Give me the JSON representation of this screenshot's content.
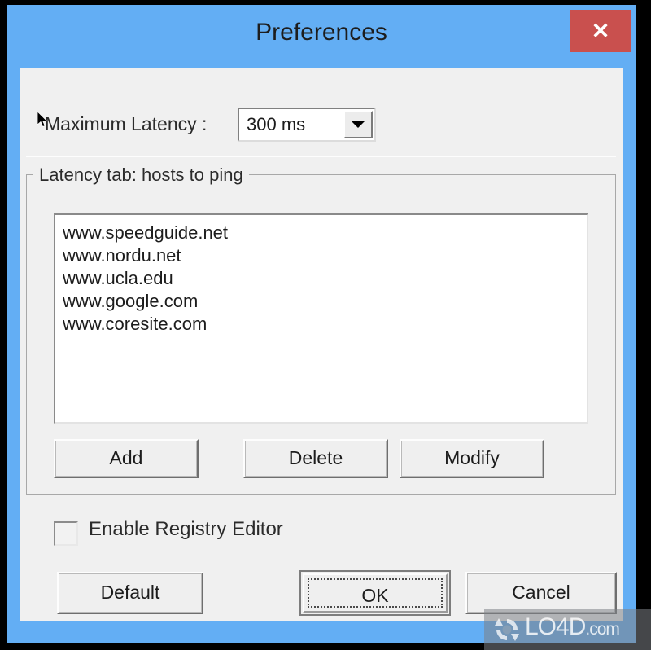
{
  "window": {
    "title": "Preferences",
    "close_label": "✕",
    "frame_color": "#63aef4",
    "close_color": "#c9504e",
    "client_color": "#f0f0f0"
  },
  "latency": {
    "label": "Maximum Latency :",
    "selected": "300 ms",
    "options": [
      "300 ms"
    ],
    "dropdown_icon": "chevron-down-icon"
  },
  "hosts_group": {
    "legend": "Latency tab: hosts to ping",
    "items": [
      "www.speedguide.net",
      "www.nordu.net",
      "www.ucla.edu",
      "www.google.com",
      "www.coresite.com"
    ],
    "buttons": {
      "add": "Add",
      "delete": "Delete",
      "modify": "Modify"
    }
  },
  "registry": {
    "label": "Enable Registry Editor",
    "checked": false
  },
  "footer": {
    "default_label": "Default",
    "ok_label": "OK",
    "cancel_label": "Cancel"
  },
  "watermark": {
    "name": "LO4D",
    "suffix": ".com",
    "logo_icon": "refresh-circle-icon"
  }
}
